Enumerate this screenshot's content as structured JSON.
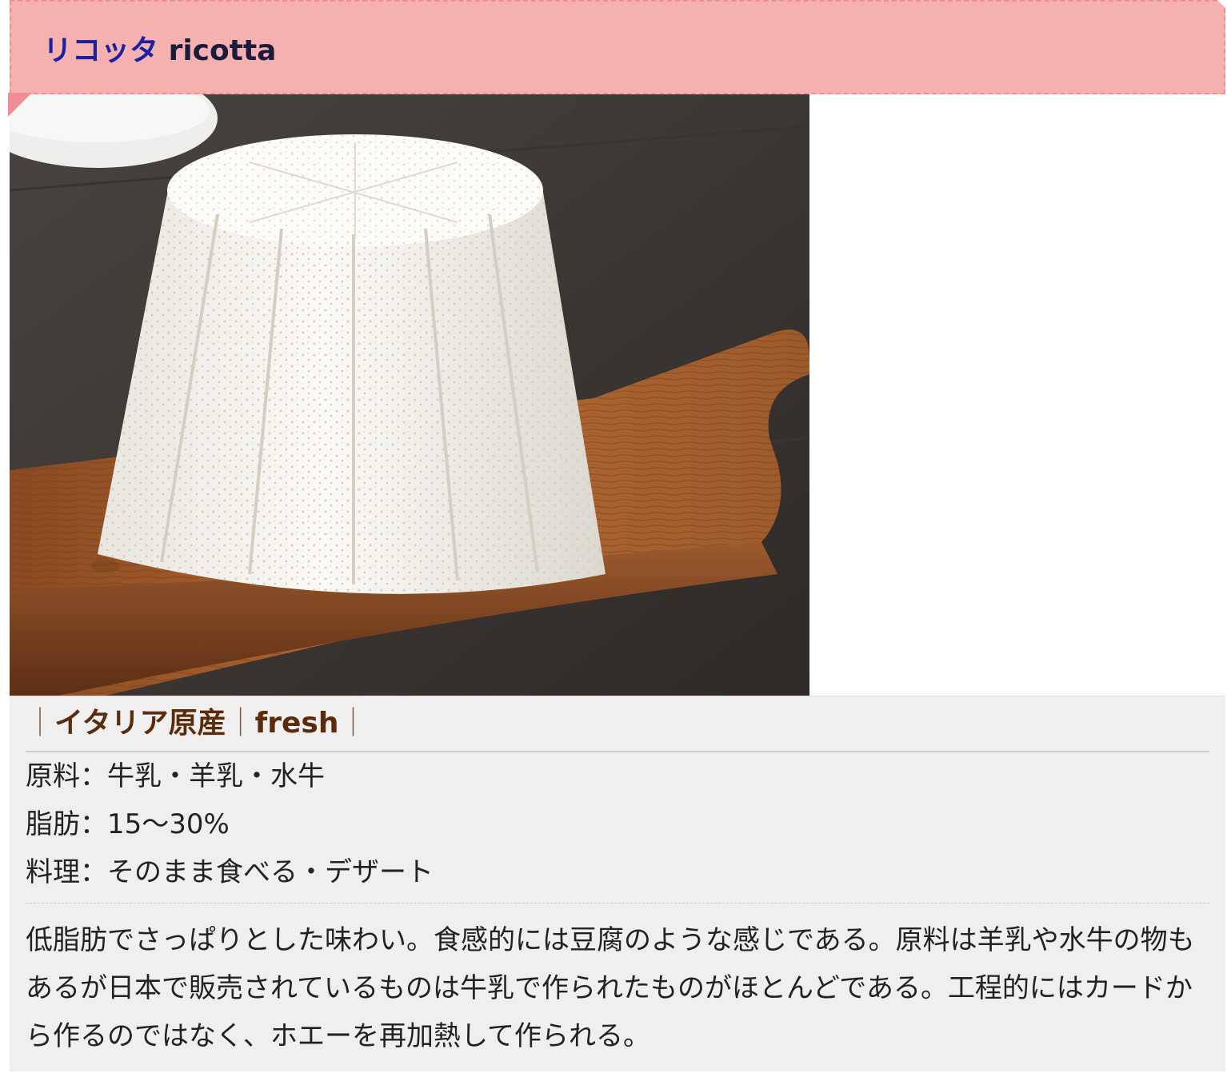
{
  "title": {
    "jp": "リコッタ",
    "en": "ricotta"
  },
  "image_alt": "ricotta cheese on wooden board",
  "tags": {
    "origin": "イタリア原産",
    "type": "fresh",
    "separator": "｜"
  },
  "specs": [
    {
      "label": "原料",
      "sep": "：",
      "value": "牛乳・羊乳・水牛"
    },
    {
      "label": "脂肪",
      "sep": "：",
      "value": "15〜30%"
    },
    {
      "label": "料理",
      "sep": "：",
      "value": "そのまま食べる・デザート"
    }
  ],
  "description": "低脂肪でさっぱりとした味わい。食感的には豆腐のような感じである。原料は羊乳や水牛の物もあるが日本で販売されているものは牛乳で作られたものがほとんどである。工程的にはカードから作るのではなく、ホエーを再加熱して作られる。",
  "colors": {
    "title_bg": "#f4b1b0",
    "title_border": "#ee8f93",
    "title_jp": "#1b1fa0",
    "tag_text": "#5a2c0c",
    "info_bg": "#efefef"
  }
}
